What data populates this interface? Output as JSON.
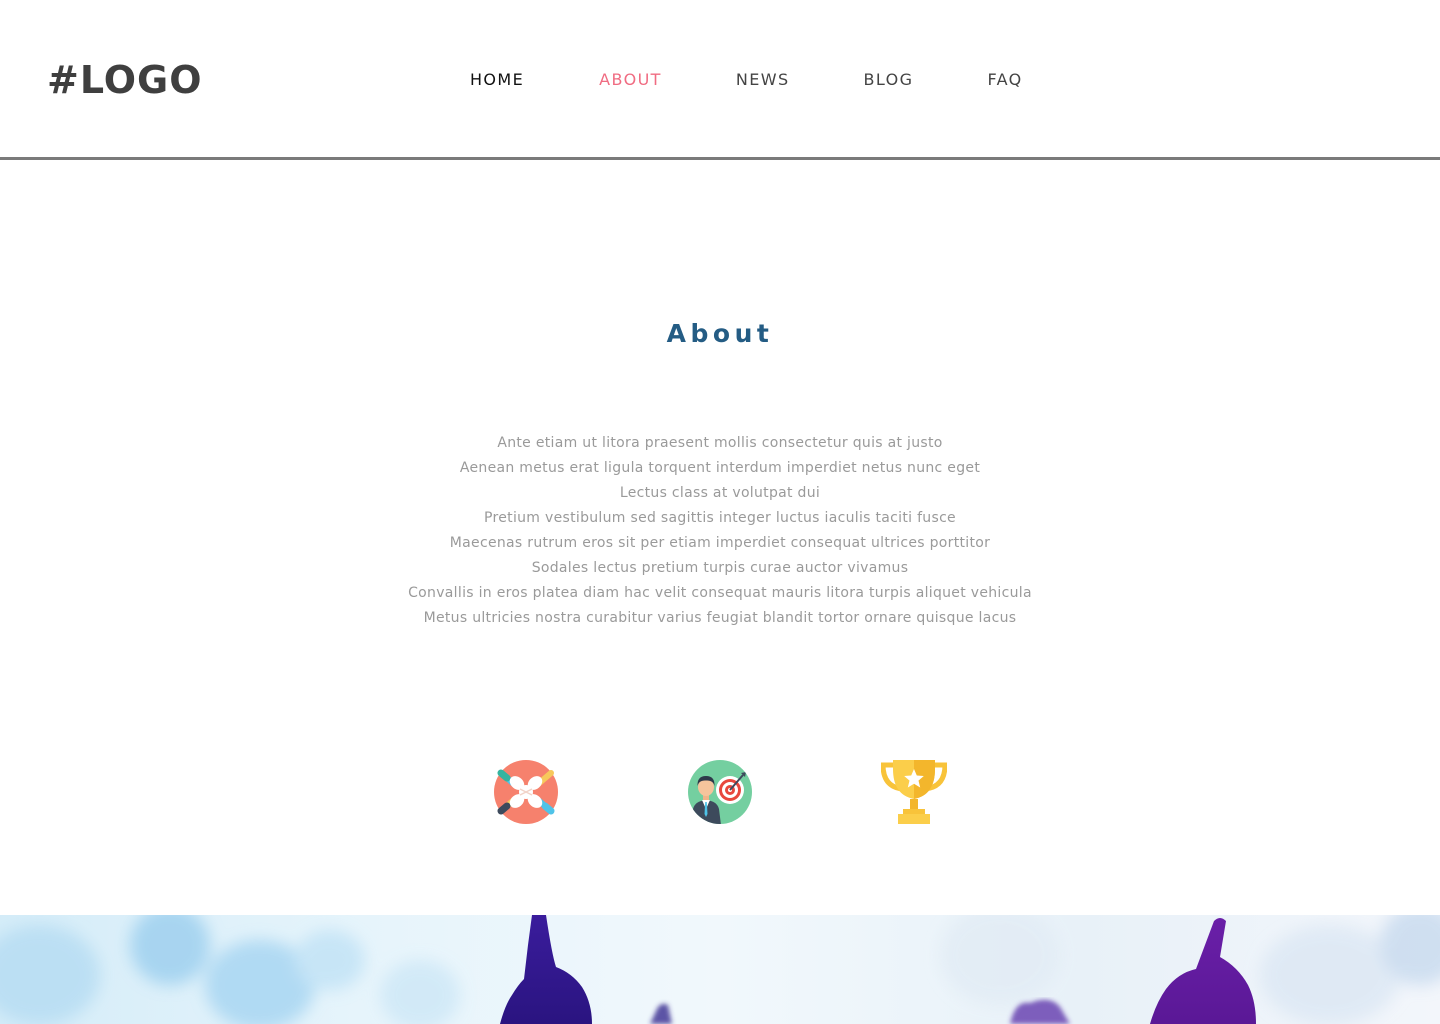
{
  "header": {
    "logo": "#LOGO",
    "nav": [
      {
        "label": "HOME"
      },
      {
        "label": "ABOUT"
      },
      {
        "label": "NEWS"
      },
      {
        "label": "BLOG"
      },
      {
        "label": "FAQ"
      }
    ],
    "active_item": "ABOUT"
  },
  "about": {
    "title": "About",
    "lines": [
      "Ante etiam ut litora praesent mollis consectetur quis at justo",
      "Aenean metus erat ligula torquent interdum imperdiet netus nunc eget",
      "Lectus class at volutpat dui",
      "Pretium vestibulum sed sagittis integer luctus iaculis taciti fusce",
      "Maecenas rutrum eros sit per etiam imperdiet consequat ultrices porttitor",
      "Sodales lectus pretium turpis curae auctor vivamus",
      "Convallis in eros platea diam hac velit consequat mauris litora turpis aliquet vehicula",
      "Metus ultricies nostra curabitur varius feugiat blandit tortor ornare quisque lacus"
    ]
  },
  "icons": [
    {
      "name": "teamwork-hands-icon"
    },
    {
      "name": "businessman-target-icon"
    },
    {
      "name": "trophy-icon"
    }
  ],
  "colors": {
    "accent": "#f06c82",
    "title": "#245c84",
    "body_text": "#9a9a9a",
    "nav_text": "#444444",
    "divider": "#7a7a7a"
  }
}
